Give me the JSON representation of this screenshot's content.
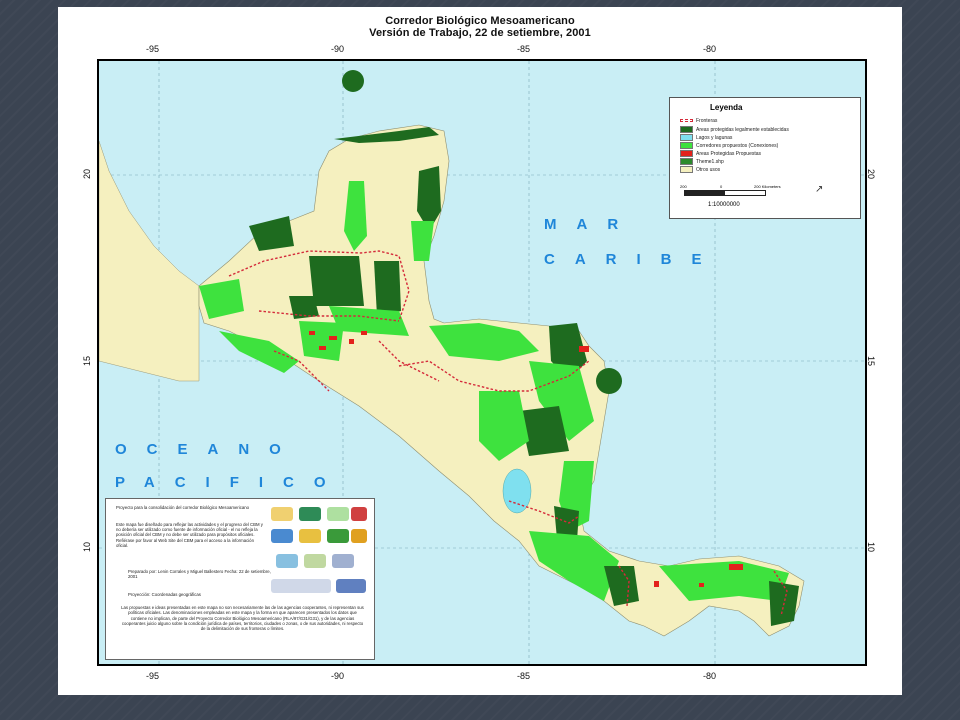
{
  "map": {
    "title_line1": "Corredor Biológico Mesoamericano",
    "title_line2": "Versión de Trabajo,  22 de setiembre, 2001",
    "lon_ticks": [
      "-95",
      "-90",
      "-85",
      "-80"
    ],
    "lat_ticks": [
      "20",
      "15",
      "10"
    ],
    "sea_caribbean_line1": "MAR",
    "sea_caribbean_line2": "CARIBE",
    "sea_pacific_line1": "OCEANO",
    "sea_pacific_line2": "PACIFICO",
    "colors": {
      "ocean": "#c9eef5",
      "land": "#f5f0bf",
      "protected": "#1e6b1f",
      "corridor": "#3ee23e",
      "proposed": "#e3221c",
      "lakes": "#7fe0ef",
      "border": "#d42a3a"
    }
  },
  "legend": {
    "title": "Leyenda",
    "items": [
      {
        "label": "Fronteras",
        "color": "#d42a3a"
      },
      {
        "label": "Areas protegidas legalmente establecidas",
        "color": "#1e6b1f"
      },
      {
        "label": "Lagos y lagunas",
        "color": "#7fe0ef"
      },
      {
        "label": "Corredores propuestos (Conexiones)",
        "color": "#3ee23e"
      },
      {
        "label": "Areas Protegidas Propuestas",
        "color": "#e3221c"
      },
      {
        "label": "Theme1.shp",
        "color": "#2c8a2c"
      },
      {
        "label": "Otros usos",
        "color": "#f5f0bf"
      }
    ],
    "scale_labels": [
      "200",
      "0",
      "200 Kilometers"
    ],
    "scale_ratio": "1:10000000"
  },
  "info": {
    "p1": "Proyecto para la consolidación del corredor Biológico Mesoamericano",
    "p2": "Este mapa fue diseñado para reflejar las actividades y el progreso del CBM y no debería ser utilizado como fuente de información oficial - el no refleja la posición oficial del CBM y no debe ser utilizado para propósitos oficiales. Refiérase por favor al Web Site del CBM para el acceso a la información oficial.",
    "p3": "Preparado por: Lenin Corrales y Miguel Ballestero Fecha: 22 de setiembre, 2001",
    "p4": "Proyección: Coordenadas geográficas",
    "p5": "Las propuestas e ideas presentadas en este mapa no son necesariamente las de las agencias cooperantes, ni representan sus políticas oficiales. Las denominaciones empleadas en este mapa y la forma en que aparecen presentados los datos que contiene no implican, de parte del Proyecto Corredor Biológico Mesoamericano (RLA/97/G31/G31), y de las agencias cooperantes juicio alguno sobre la condición jurídica de países, territorios, ciudades o zonas, o de sus autoridades, ni respecto de la delimitación de sus fronteras o límites."
  }
}
